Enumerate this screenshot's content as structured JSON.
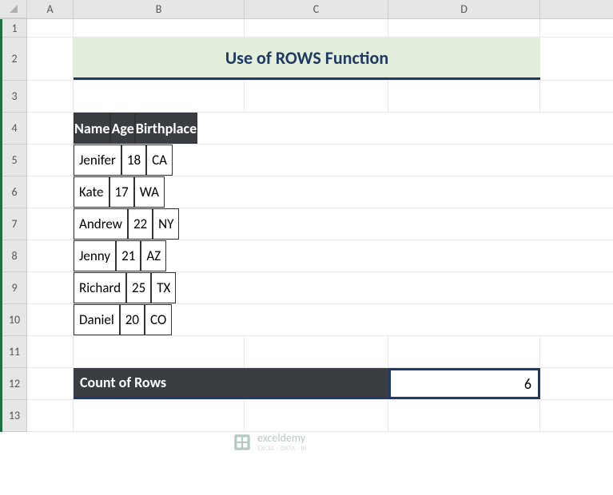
{
  "columns": [
    "A",
    "B",
    "C",
    "D"
  ],
  "rows": [
    "1",
    "2",
    "3",
    "4",
    "5",
    "6",
    "7",
    "8",
    "9",
    "10",
    "11",
    "12",
    "13"
  ],
  "title": "Use of ROWS Function",
  "table": {
    "headers": [
      "Name",
      "Age",
      "Birthplace"
    ],
    "rows": [
      {
        "name": "Jenifer",
        "age": "18",
        "bp": "CA"
      },
      {
        "name": "Kate",
        "age": "17",
        "bp": "WA"
      },
      {
        "name": "Andrew",
        "age": "22",
        "bp": "NY"
      },
      {
        "name": "Jenny",
        "age": "21",
        "bp": "AZ"
      },
      {
        "name": "Richard",
        "age": "25",
        "bp": "TX"
      },
      {
        "name": "Daniel",
        "age": "20",
        "bp": "CO"
      }
    ]
  },
  "count": {
    "label": "Count of Rows",
    "value": "6"
  },
  "watermark": {
    "brand": "exceldemy",
    "sub": "EXCEL · DATA · BI"
  }
}
